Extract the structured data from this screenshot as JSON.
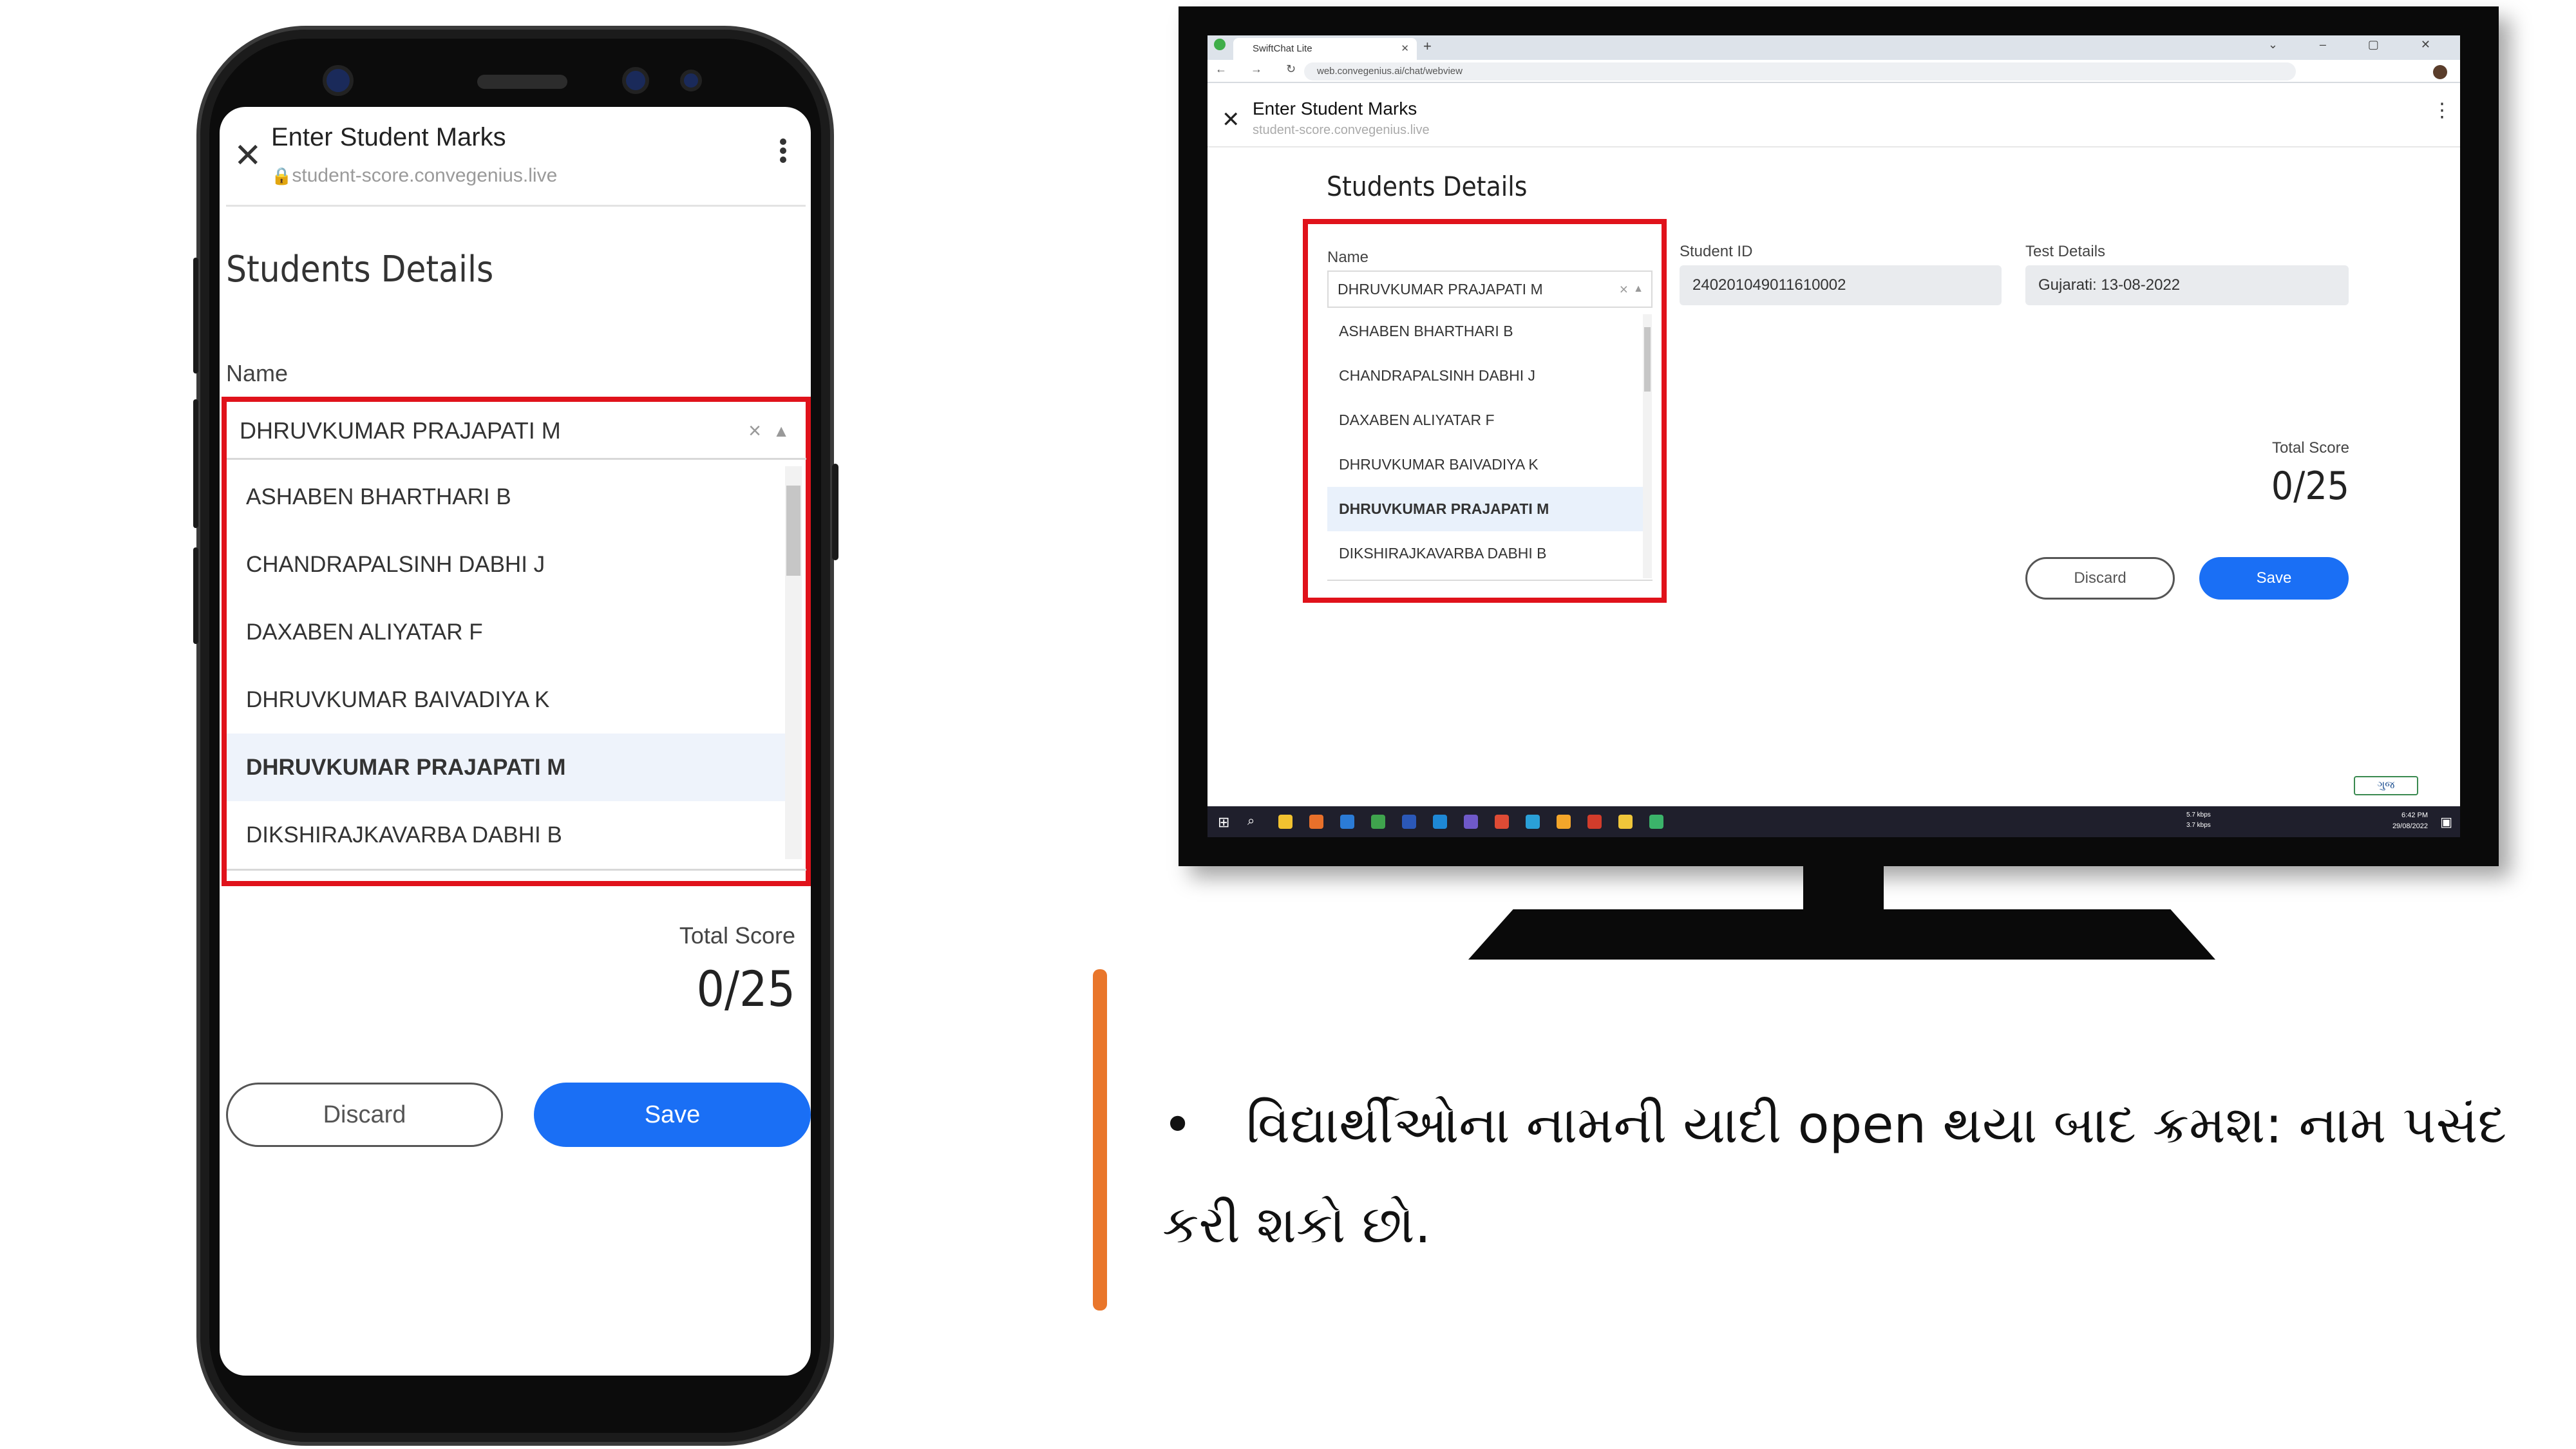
{
  "app": {
    "title": "Enter Student Marks",
    "url": "student-score.convegenius.live",
    "section_title": "Students Details"
  },
  "form": {
    "name_label": "Name",
    "selected_name": "DHRUVKUMAR PRAJAPATI M",
    "clear_symbol": "×",
    "student_id_label": "Student ID",
    "student_id_value": "240201049011610002",
    "test_details_label": "Test Details",
    "test_details_value": "Gujarati: 13-08-2022",
    "total_score_label": "Total Score",
    "total_score_value": "0/25",
    "discard_label": "Discard",
    "save_label": "Save"
  },
  "students": [
    {
      "name": "ASHABEN BHARTHARI B",
      "selected": false
    },
    {
      "name": "CHANDRAPALSINH DABHI J",
      "selected": false
    },
    {
      "name": "DAXABEN ALIYATAR F",
      "selected": false
    },
    {
      "name": "DHRUVKUMAR BAIVADIYA K",
      "selected": false
    },
    {
      "name": "DHRUVKUMAR PRAJAPATI M",
      "selected": true
    },
    {
      "name": "DIKSHIRAJKAVARBA DABHI B",
      "selected": false
    }
  ],
  "browser": {
    "tab_title": "SwiftChat Lite",
    "address": "web.convegenius.ai/chat/webview",
    "net_up": "5.7 kbps",
    "net_down": "3.7 kbps",
    "clock_time": "6:42 PM",
    "clock_date": "29/08/2022",
    "language_indicator": "ગુજ"
  },
  "caption": {
    "bullet": "•",
    "line1": "વિદ્યાર્થીઓના નામની યાદી open થયા બાદ ક્રમશ: નામ પસંદ",
    "line2": "કરી શકો છો."
  },
  "colors": {
    "accent_blue": "#1a6ff5",
    "highlight_red": "#e0121b",
    "divider_orange": "#e9762b",
    "selected_row_bg": "#eef3fb"
  }
}
